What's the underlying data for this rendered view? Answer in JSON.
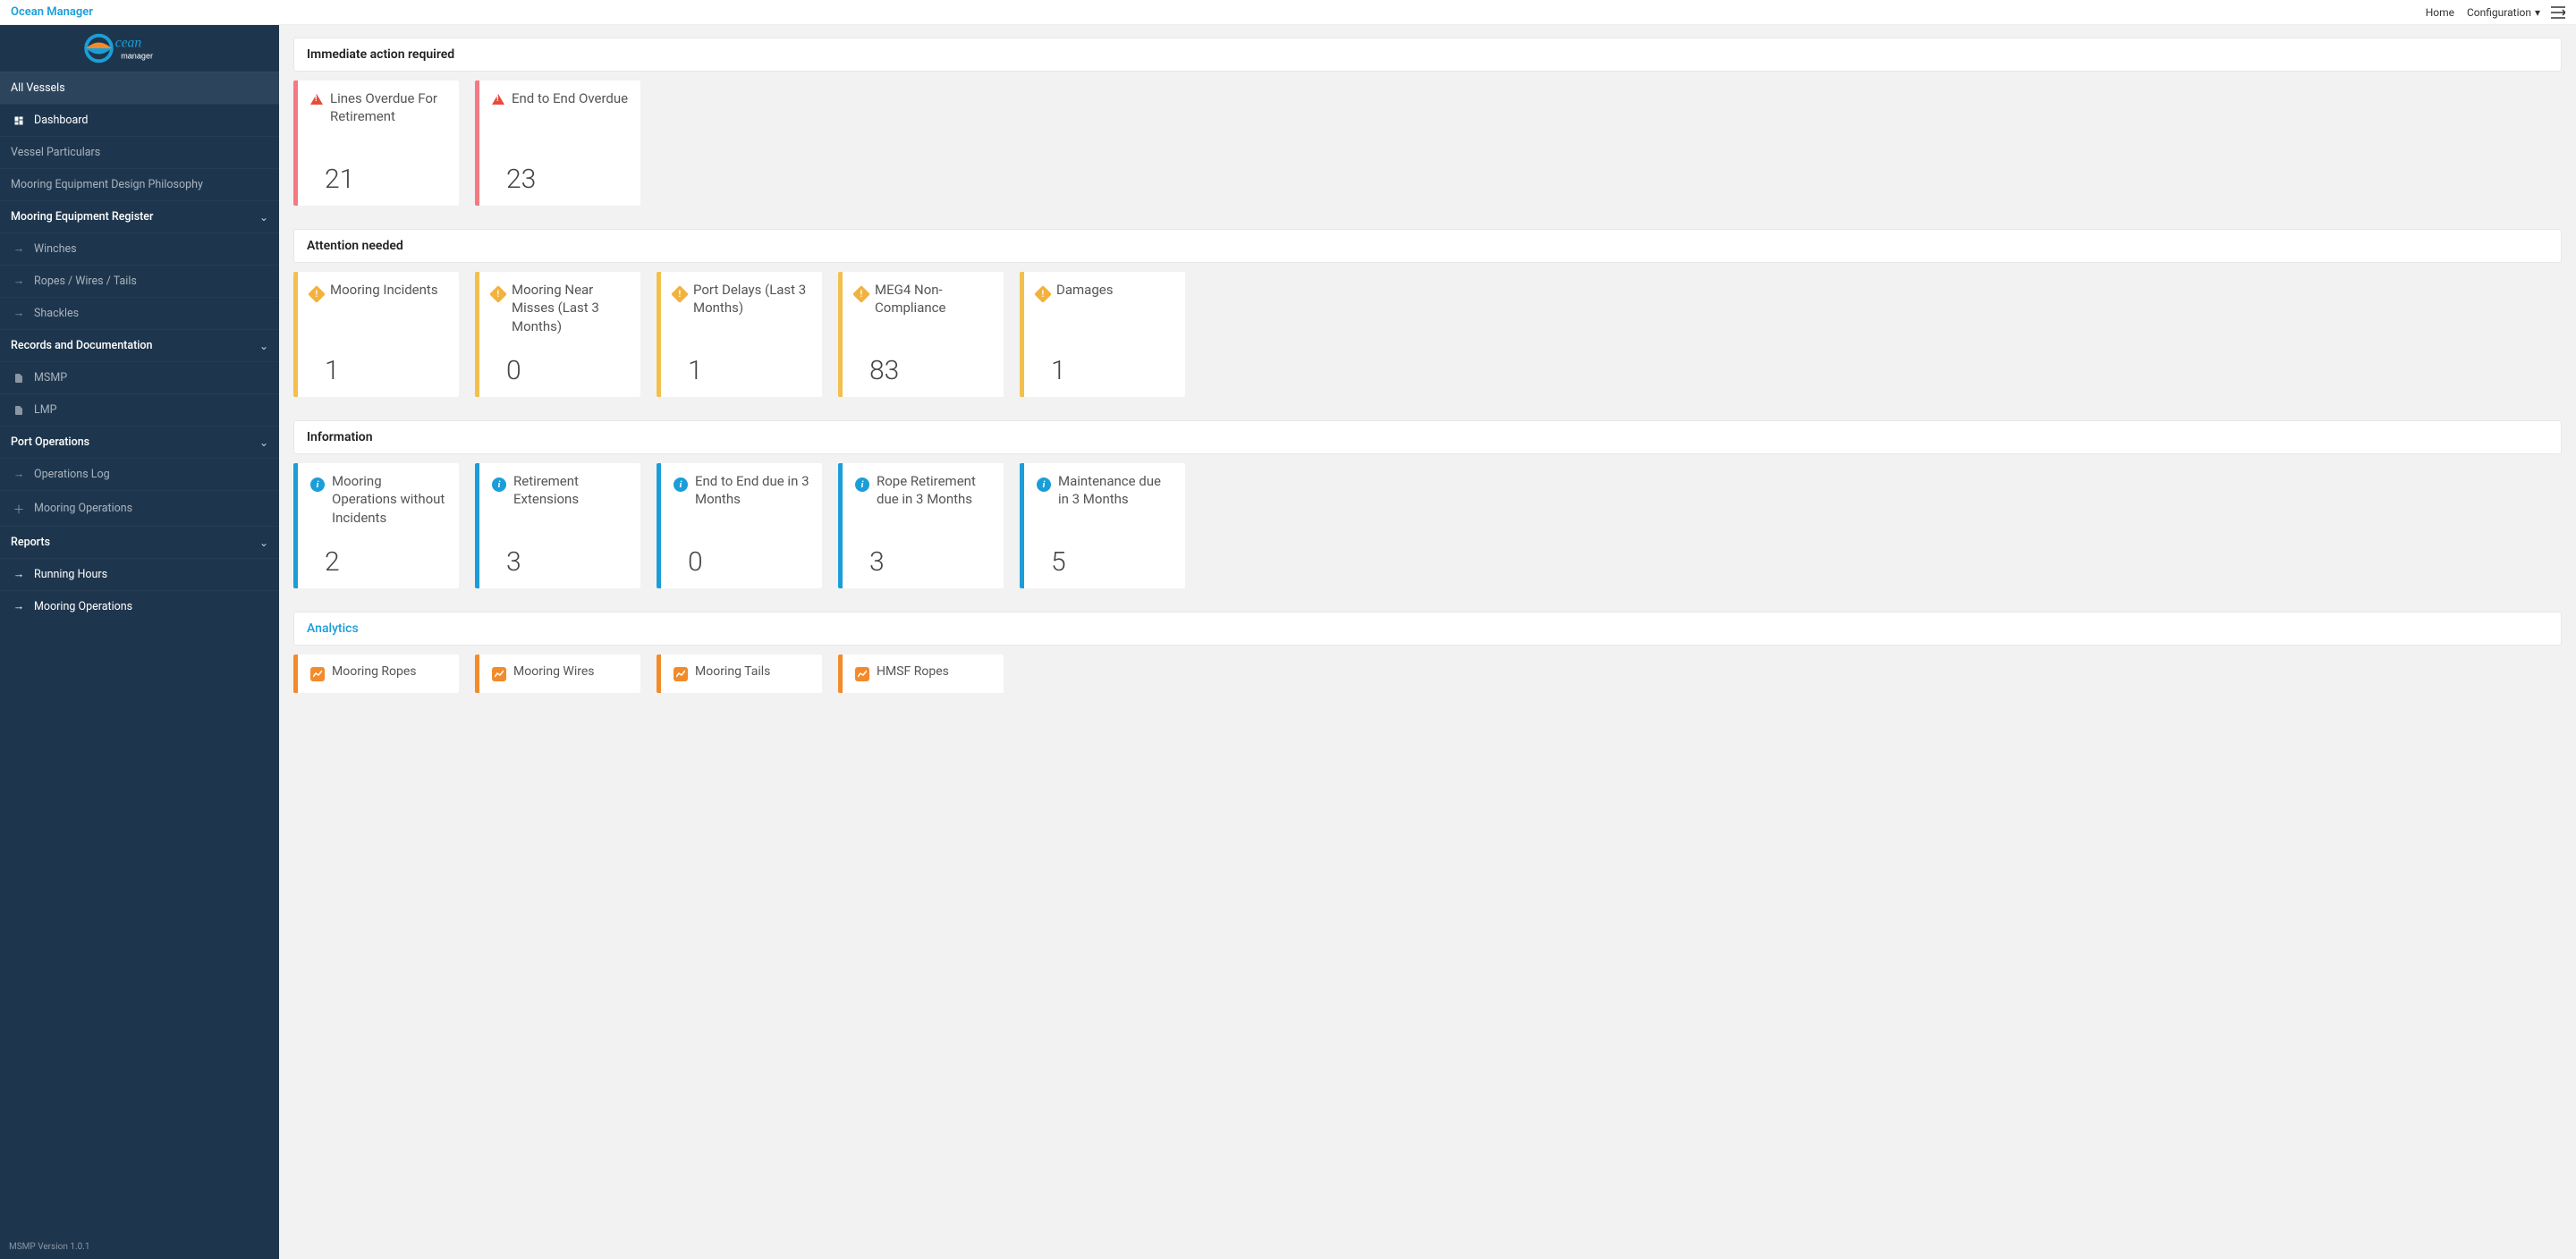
{
  "header": {
    "brand": "Ocean Manager",
    "home": "Home",
    "configuration": "Configuration"
  },
  "sidebar": {
    "all_vessels": "All Vessels",
    "dashboard": "Dashboard",
    "vessel_particulars": "Vessel Particulars",
    "design_philosophy": "Mooring Equipment Design Philosophy",
    "register": "Mooring Equipment Register",
    "register_items": {
      "winches": "Winches",
      "ropes": "Ropes / Wires / Tails",
      "shackles": "Shackles"
    },
    "records": "Records and Documentation",
    "records_items": {
      "msmp": "MSMP",
      "lmp": "LMP"
    },
    "port_ops": "Port Operations",
    "port_ops_items": {
      "ops_log": "Operations Log",
      "mooring_ops": "Mooring Operations"
    },
    "reports": "Reports",
    "reports_items": {
      "running_hours": "Running Hours",
      "mooring_ops": "Mooring Operations"
    },
    "version": "MSMP Version 1.0.1"
  },
  "sections": {
    "immediate": "Immediate action required",
    "attention": "Attention needed",
    "information": "Information",
    "analytics": "Analytics"
  },
  "cards": {
    "immediate": [
      {
        "label": "Lines Overdue For Retirement",
        "value": "21"
      },
      {
        "label": "End to End Overdue",
        "value": "23"
      }
    ],
    "attention": [
      {
        "label": "Mooring Incidents",
        "value": "1"
      },
      {
        "label": "Mooring Near Misses (Last 3 Months)",
        "value": "0"
      },
      {
        "label": "Port Delays (Last 3 Months)",
        "value": "1"
      },
      {
        "label": "MEG4 Non-Compliance",
        "value": "83"
      },
      {
        "label": "Damages",
        "value": "1"
      }
    ],
    "info": [
      {
        "label": "Mooring Operations without Incidents",
        "value": "2"
      },
      {
        "label": "Retirement Extensions",
        "value": "3"
      },
      {
        "label": "End to End due in 3 Months",
        "value": "0"
      },
      {
        "label": "Rope Retirement due in 3 Months",
        "value": "3"
      },
      {
        "label": "Maintenance due in 3 Months",
        "value": "5"
      }
    ],
    "analytics": [
      {
        "label": "Mooring Ropes"
      },
      {
        "label": "Mooring Wires"
      },
      {
        "label": "Mooring Tails"
      },
      {
        "label": "HMSF Ropes"
      }
    ]
  }
}
